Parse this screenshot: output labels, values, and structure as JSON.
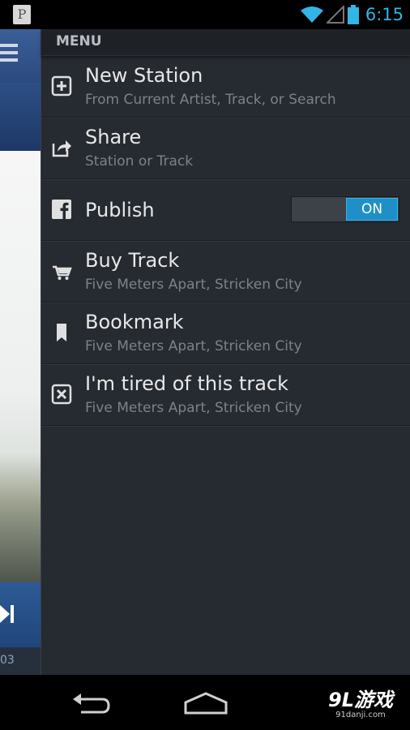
{
  "status_bar": {
    "notification_icon": "pandora-p-icon",
    "notification_letter": "P",
    "time": "6:15",
    "icons": [
      "wifi-icon",
      "signal-icon",
      "battery-icon"
    ],
    "accent_color": "#33b5e5"
  },
  "behind_panel": {
    "time_text": "03",
    "icons": [
      "hamburger-menu-icon",
      "skip-forward-icon"
    ]
  },
  "menu": {
    "header": "MENU",
    "items": [
      {
        "title": "New Station",
        "subtitle": "From Current Artist, Track, or Search",
        "icon": "plus-box-icon"
      },
      {
        "title": "Share",
        "subtitle": "Station or Track",
        "icon": "share-icon"
      },
      {
        "title": "Publish",
        "icon": "facebook-icon",
        "toggle_label": "ON",
        "toggle_state": true
      },
      {
        "title": "Buy Track",
        "subtitle": "Five Meters Apart, Stricken City",
        "icon": "cart-icon"
      },
      {
        "title": "Bookmark",
        "subtitle": "Five Meters Apart, Stricken City",
        "icon": "bookmark-icon"
      },
      {
        "title": "I'm tired of this track",
        "subtitle": "Five Meters Apart, Stricken City",
        "icon": "close-box-icon"
      }
    ]
  },
  "nav_bar": {
    "icons": [
      "back-icon",
      "home-icon"
    ],
    "watermark_logo": "9L游戏",
    "watermark_url": "91danji.com"
  }
}
